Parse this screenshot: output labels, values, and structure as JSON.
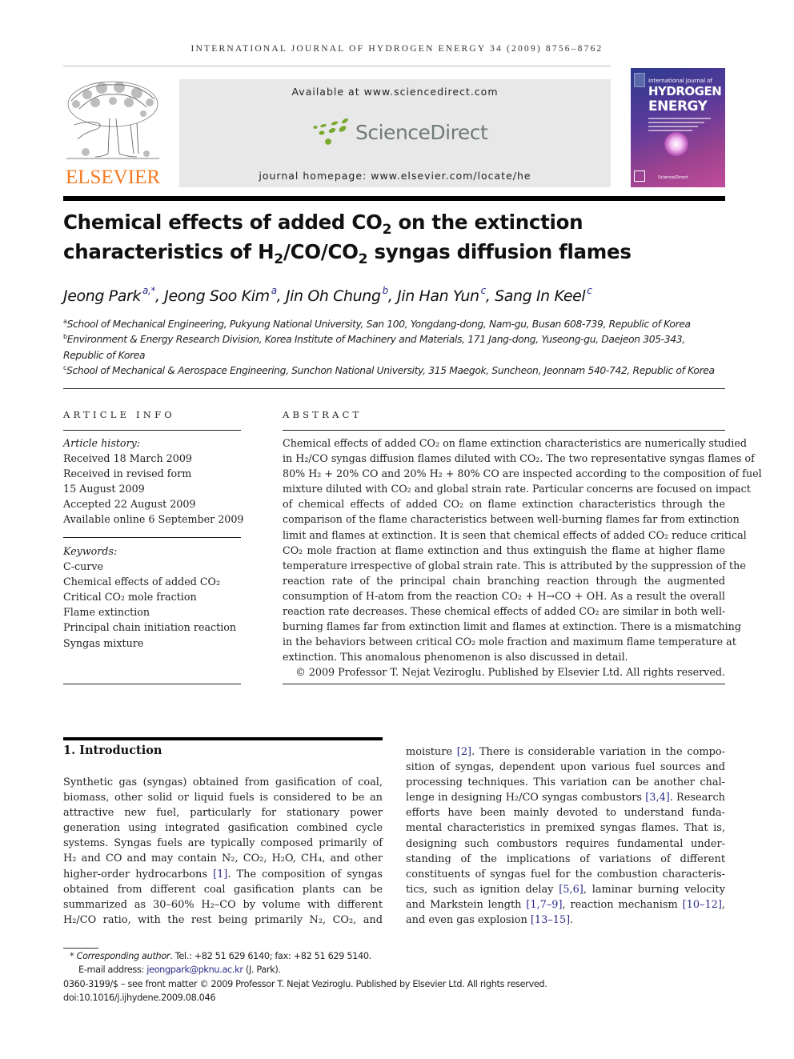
{
  "running_header": "INTERNATIONAL JOURNAL OF HYDROGEN ENERGY 34 (2009) 8756–8762",
  "publisher_logo": {
    "name": "ELSEVIER",
    "color": "#f47920"
  },
  "sciencedirect_box": {
    "available": "Available at www.sciencedirect.com",
    "logo_text": "ScienceDirect",
    "logo_color": "#6f7b73",
    "dots_color": "#79a82c",
    "homepage": "journal homepage: www.elsevier.com/locate/he"
  },
  "journal_cover": {
    "line1": "International Journal of",
    "line2": "HYDROGEN",
    "line3": "ENERGY",
    "footer": "ScienceDirect"
  },
  "title": {
    "line1_a": "Chemical effects of added CO",
    "line1_sub": "2",
    "line1_b": " on the extinction",
    "line2_a": "characteristics of H",
    "line2_sub1": "2",
    "line2_b": "/CO/CO",
    "line2_sub2": "2",
    "line2_c": " syngas diffusion flames"
  },
  "authors": [
    {
      "name": "Jeong Park",
      "aff": "a,*",
      "sep": ", "
    },
    {
      "name": "Jeong Soo Kim",
      "aff": "a",
      "sep": ", "
    },
    {
      "name": "Jin Oh Chung",
      "aff": "b",
      "sep": ", "
    },
    {
      "name": "Jin Han Yun",
      "aff": "c",
      "sep": ", "
    },
    {
      "name": "Sang In Keel",
      "aff": "c",
      "sep": ""
    }
  ],
  "affiliations": [
    {
      "key": "a",
      "text": "School of Mechanical Engineering, Pukyung National University, San 100, Yongdang-dong, Nam-gu, Busan 608-739, Republic of Korea"
    },
    {
      "key": "b",
      "text": "Environment & Energy Research Division, Korea Institute of Machinery and Materials, 171 Jang-dong, Yuseong-gu, Daejeon 305-343,",
      "cont": "Republic of Korea"
    },
    {
      "key": "c",
      "text": "School of Mechanical & Aerospace Engineering, Sunchon National University, 315 Maegok, Suncheon, Jeonnam 540-742, Republic of Korea"
    }
  ],
  "article_info": {
    "label": "ARTICLE INFO",
    "history_label": "Article history:",
    "history": [
      "Received 18 March 2009",
      "Received in revised form",
      "15 August 2009",
      "Accepted 22 August 2009",
      "Available online 6 September 2009"
    ],
    "keywords_label": "Keywords:",
    "keywords": [
      "C-curve",
      "Chemical effects of added CO₂",
      "Critical CO₂ mole fraction",
      "Flame extinction",
      "Principal chain initiation reaction",
      "Syngas mixture"
    ]
  },
  "abstract": {
    "label": "ABSTRACT",
    "lines": [
      "Chemical effects of added CO₂ on flame extinction characteristics are numerically studied",
      "in H₂/CO syngas diffusion flames diluted with CO₂. The two representative syngas flames of",
      "80% H₂ + 20% CO and 20% H₂ + 80% CO are inspected according to the composition of fuel",
      "mixture diluted with CO₂ and global strain rate. Particular concerns are focused on impact",
      "of chemical effects of added CO₂ on flame extinction characteristics through the",
      "comparison of the flame characteristics between well-burning flames far from extinction",
      "limit and flames at extinction. It is seen that chemical effects of added CO₂ reduce critical",
      "CO₂ mole fraction at flame extinction and thus extinguish the flame at higher flame",
      "temperature irrespective of global strain rate. This is attributed by the suppression of the",
      "reaction rate of the principal chain branching reaction through the augmented",
      "consumption of H-atom from the reaction CO₂ + H→CO + OH. As a result the overall",
      "reaction rate decreases. These chemical effects of added CO₂ are similar in both well-",
      "burning flames far from extinction limit and flames at extinction. There is a mismatching",
      "in the behaviors between critical CO₂ mole fraction and maximum flame temperature at",
      "extinction. This anomalous phenomenon is also discussed in detail."
    ],
    "copyright": "© 2009 Professor T. Nejat Veziroglu. Published by Elsevier Ltd. All rights reserved."
  },
  "introduction": {
    "heading": "1.  Introduction",
    "left_lines": [
      "Synthetic gas (syngas) obtained from gasification of coal,",
      "biomass, other solid or liquid fuels is considered to be an",
      "attractive new fuel, particularly for stationary power",
      "generation using integrated gasification combined cycle",
      "systems. Syngas fuels are typically composed primarily of",
      "H₂ and CO and may contain N₂, CO₂, H₂O, CH₄, and other",
      "higher-order hydrocarbons [1]. The composition of syngas",
      "obtained from different coal gasification plants can be",
      "summarized as 30–60% H₂–CO by volume with different",
      "H₂/CO ratio, with the rest being primarily N₂, CO₂, and"
    ],
    "right_lines": [
      "moisture [2]. There is considerable variation in the compo-",
      "sition of syngas, dependent upon various fuel sources and",
      "processing techniques. This variation can be another chal-",
      "lenge in designing H₂/CO syngas combustors [3,4]. Research",
      "efforts have been mainly devoted to understand funda-",
      "mental characteristics in premixed syngas flames. That is,",
      "designing such combustors requires fundamental under-",
      "standing of the implications of variations of different",
      "constituents of syngas fuel for the combustion characteris-",
      "tics, such as ignition delay [5,6], laminar burning velocity",
      "and Markstein length [1,7–9], reaction mechanism [10–12],",
      "and even gas explosion [13–15]."
    ],
    "citation_color": "#2b2b8a"
  },
  "footnotes": {
    "corresponding_mark": "*",
    "corresponding_label": "Corresponding author",
    "contact": ". Tel.: +82 51 629 6140; fax: +82 51 629 5140.",
    "email_label": "E-mail address: ",
    "email": "jeongpark@pknu.ac.kr",
    "email_suffix": " (J. Park).",
    "issn_line": "0360-3199/$ – see front matter © 2009 Professor T. Nejat Veziroglu. Published by Elsevier Ltd. All rights reserved.",
    "doi": "doi:10.1016/j.ijhydene.2009.08.046"
  }
}
